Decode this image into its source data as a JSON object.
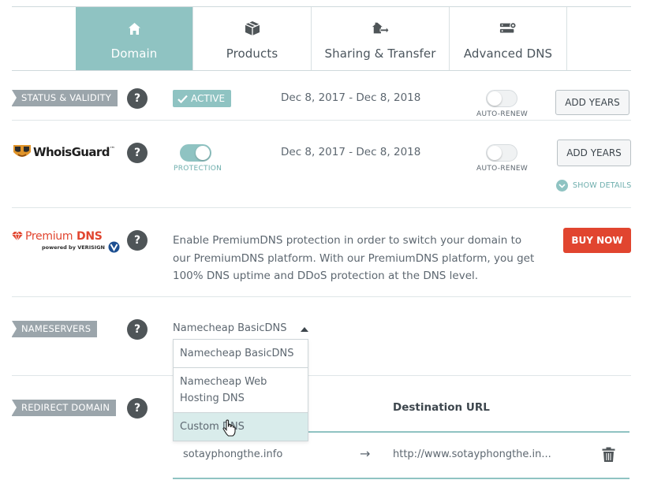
{
  "tabs": [
    {
      "label": "Domain",
      "icon": "home-icon",
      "active": true
    },
    {
      "label": "Products",
      "icon": "box-icon",
      "active": false
    },
    {
      "label": "Sharing & Transfer",
      "icon": "house-transfer-icon",
      "active": false
    },
    {
      "label": "Advanced DNS",
      "icon": "server-gear-icon",
      "active": false
    }
  ],
  "status": {
    "section_label": "STATUS & VALIDITY",
    "badge": "ACTIVE",
    "dates": "Dec 8, 2017 - Dec 8, 2018",
    "auto_renew_label": "AUTO-RENEW",
    "auto_renew_on": false,
    "add_years_label": "ADD YEARS"
  },
  "whoisguard": {
    "logo_text": "WhoisGuard",
    "logo_tm": "™",
    "protection_label": "PROTECTION",
    "protection_on": true,
    "dates": "Dec 8, 2017 - Dec 8, 2018",
    "auto_renew_label": "AUTO-RENEW",
    "auto_renew_on": false,
    "add_years_label": "ADD YEARS",
    "show_details_label": "SHOW DETAILS"
  },
  "premium_dns": {
    "logo_premium": "Premium",
    "logo_dns": "DNS",
    "logo_powered": "powered by VERISIGN",
    "description": "Enable PremiumDNS protection in order to switch your domain to our PremiumDNS platform. With our PremiumDNS platform, you get 100% DNS uptime and DDoS protection at the DNS level.",
    "buy_label": "BUY NOW"
  },
  "nameservers": {
    "section_label": "NAMESERVERS",
    "selected": "Namecheap BasicDNS",
    "options": [
      "Namecheap BasicDNS",
      "Namecheap Web Hosting DNS",
      "Custom DNS"
    ],
    "hovered_index": 2
  },
  "redirect": {
    "section_label": "REDIRECT DOMAIN",
    "destination_header": "Destination URL",
    "rows": [
      {
        "source": "sotayphongthe.info",
        "arrow": "→",
        "destination": "http://www.sotayphongthe.in..."
      }
    ]
  },
  "colors": {
    "accent": "#8fc3c2",
    "buy": "#e1452f",
    "ribbon": "#9ba5ab",
    "help": "#4f5558"
  }
}
